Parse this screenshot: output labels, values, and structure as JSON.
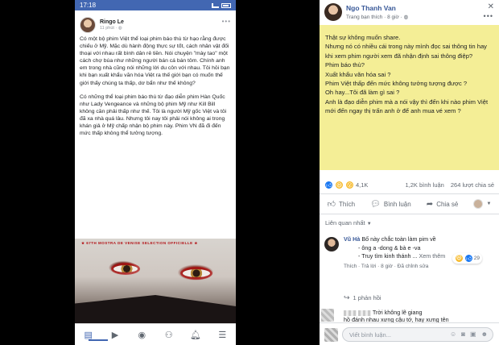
{
  "phone": {
    "status_time": "17:18",
    "post": {
      "author": "Ringo Le",
      "time": "11 phút · ",
      "paragraphs": [
        "Có một bộ phim Việt thể loại phim báo thù từ hạo rằng được chiếu ở Mỹ. Mặc dù hành động thực sự tốt, cách nhân vật đối thoại với nhau rất bình dân rẻ tiền. Nói chuyện \"mày tao\" một cách chợ búa như những người bán cá bán tôm. Chính anh em trong nhà cũng nói những lời du côn với nhau. Tôi hỏi bạn khi bạn xuất khẩu văn hóa Việt ra thế giới bạn có muốn thế giới thấy chúng ta thấp, dơ bẩn như thế không?",
        "Có những thể loại phim báo thù từ đạo diễn phim Hàn Quốc như Lady Vengeance và những bộ phim Mỹ như Kill Bill không cần phải thấp như thế. Tôi là người Mỹ gốc Việt và tôi đã xa nhà quá lâu. Nhưng tôi nay tôi phải nói không ai trong khán giả ở Mỹ chấp nhận bộ phim này. Phim VN đã đi đến mức thấp không thể tưởng tượng."
      ],
      "poster_caption": "★ 67TH MOSTRA DE VENISE SELECTION OFFICIELLE ★"
    },
    "tabs": [
      "news-feed",
      "video",
      "profile",
      "groups",
      "notifications",
      "menu"
    ]
  },
  "panel": {
    "author": "Ngo Thanh Van",
    "meta": "Trang bạn thích · 8 giờ · ",
    "post_text": "Thật sự không muốn share.\nNhưng nó có nhiều cái trong này mình đọc sai thông tin hay khi xem phim người xem đã nhận định sai thông điệp?\nPhim báo thù?\nXuất khẩu văn hóa sai ?\nPhim Việt thấp đến mức không tưởng tượng được ?\nOh hay...Tôi đã làm gì sai ?\nAnh là đạo diễn phim mà a nói vậy thì đến khi nào phim Việt mới đến ngay thị trấn anh ở để anh mua vé xem ?",
    "reactions_count": "4,1K",
    "comments_count": "1,2K bình luận",
    "shares_count": "264 lượt chia sẻ",
    "actions": {
      "like": "Thích",
      "comment": "Bình luận",
      "share": "Chia sẻ"
    },
    "sort_label": "Liên quan nhất",
    "comment": {
      "author": "Vũ Hà",
      "line1": "Bố này chắc toàn làm pim về",
      "line2": "- ông a -dong & bà e -va",
      "line3": "- Truy tìm kinh thánh ...",
      "see_more": "Xem thêm",
      "meta": "Thích · Trả lời · 8 giờ · Đã chỉnh sửa",
      "reaction_count": "29"
    },
    "replies_label": "1 phản hồi",
    "comment2": {
      "line1": "Trời không lẽ giang",
      "line2": "hồ đánh nhau xưng cậu tớ, hay xưng tên"
    },
    "write_placeholder": "Viết bình luận..."
  }
}
